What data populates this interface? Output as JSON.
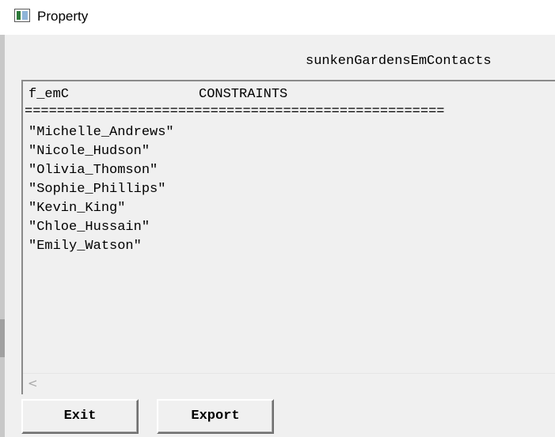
{
  "window": {
    "title": "Property",
    "icon": "application-window-icon"
  },
  "header": {
    "name": "sunkenGardensEmContacts"
  },
  "content": {
    "field_name": "f_emC",
    "column_label": "CONSTRAINTS",
    "separator": "====================================================",
    "items": [
      "\"Michelle_Andrews\"",
      "\"Nicole_Hudson\"",
      "\"Olivia_Thomson\"",
      "\"Sophie_Phillips\"",
      "\"Kevin_King\"",
      "\"Chloe_Hussain\"",
      "\"Emily_Watson\""
    ]
  },
  "scrollbar": {
    "left_arrow": "<"
  },
  "buttons": {
    "exit": "Exit",
    "export": "Export"
  }
}
